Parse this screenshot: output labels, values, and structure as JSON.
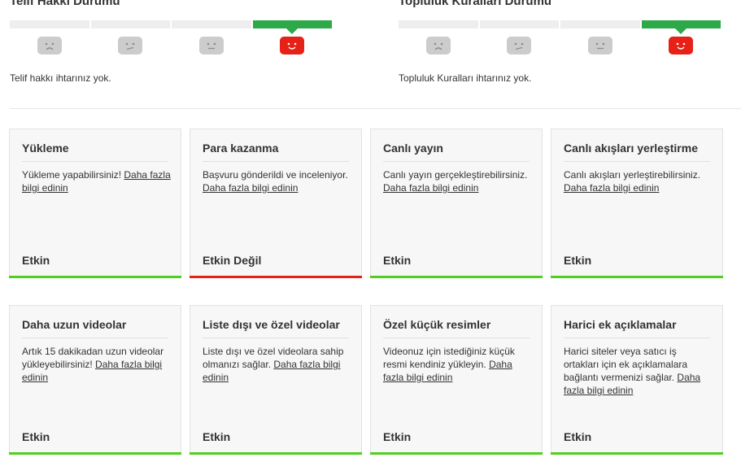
{
  "copyright": {
    "title": "Telif Hakkı Durumu",
    "message": "Telif hakkı ihtarınız yok.",
    "level": 4,
    "levels": 4
  },
  "community": {
    "title": "Topluluk Kuralları Durumu",
    "message": "Topluluk Kuralları ihtarınız yok.",
    "level": 4,
    "levels": 4
  },
  "colors": {
    "meter_active": "#2ea94a",
    "meter_inactive": "#eeeeee",
    "face_active": "#e62117",
    "face_inactive": "#cccccc",
    "status_enabled": "#4fcf1e",
    "status_disabled": "#e62117"
  },
  "features": [
    {
      "title": "Yükleme",
      "desc": "Yükleme yapabilirsiniz! ",
      "link": "Daha fazla bilgi edinin",
      "status": "Etkin",
      "enabled": true
    },
    {
      "title": "Para kazanma",
      "desc": "Başvuru gönderildi ve inceleniyor. ",
      "link": "Daha fazla bilgi edinin",
      "status": "Etkin Değil",
      "enabled": false
    },
    {
      "title": "Canlı yayın",
      "desc": "Canlı yayın gerçekleştirebilirsiniz. ",
      "link": "Daha fazla bilgi edinin",
      "status": "Etkin",
      "enabled": true
    },
    {
      "title": "Canlı akışları yerleştirme",
      "desc": "Canlı akışları yerleştirebilirsiniz. ",
      "link": "Daha fazla bilgi edinin",
      "status": "Etkin",
      "enabled": true
    },
    {
      "title": "Daha uzun videolar",
      "desc": "Artık 15 dakikadan uzun videolar yükleyebilirsiniz! ",
      "link": "Daha fazla bilgi edinin",
      "status": "Etkin",
      "enabled": true
    },
    {
      "title": "Liste dışı ve özel videolar",
      "desc": "Liste dışı ve özel videolara sahip olmanızı sağlar. ",
      "link": "Daha fazla bilgi edinin",
      "status": "Etkin",
      "enabled": true
    },
    {
      "title": "Özel küçük resimler",
      "desc": "Videonuz için istediğiniz küçük resmi kendiniz yükleyin. ",
      "link": "Daha fazla bilgi edinin",
      "status": "Etkin",
      "enabled": true
    },
    {
      "title": "Harici ek açıklamalar",
      "desc": "Harici siteler veya satıcı iş ortakları için ek açıklamalara bağlantı vermenizi sağlar. ",
      "link": "Daha fazla bilgi edinin",
      "status": "Etkin",
      "enabled": true
    }
  ]
}
